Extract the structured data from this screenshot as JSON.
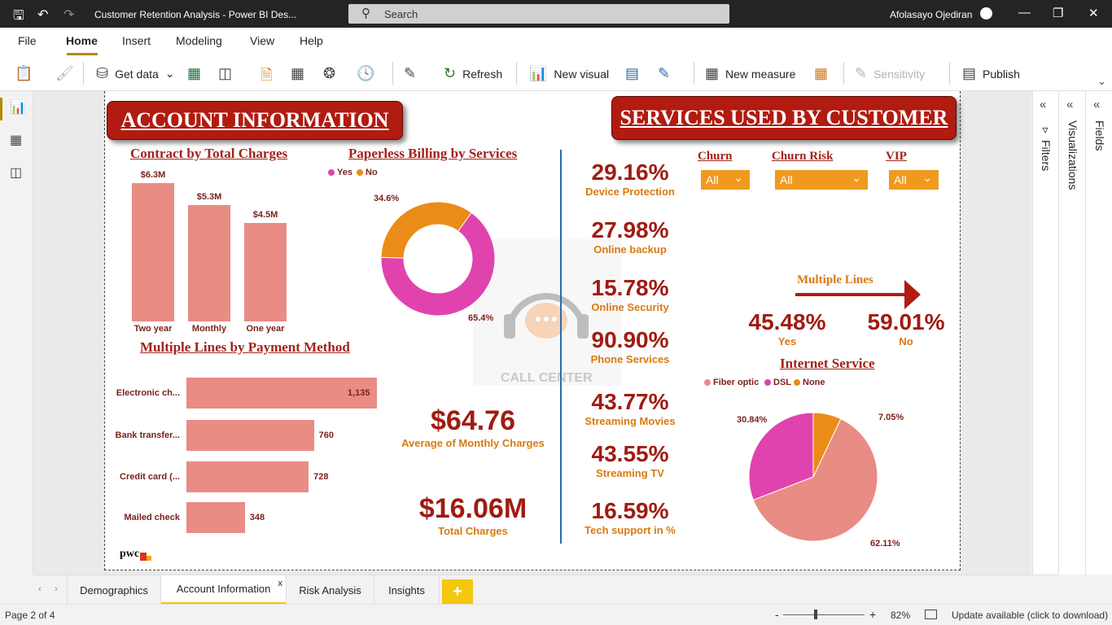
{
  "titlebar": {
    "title": "Customer Retention Analysis - Power BI Des...",
    "search_placeholder": "Search",
    "user": "Afolasayo Ojediran"
  },
  "menu": {
    "items": [
      "File",
      "Home",
      "Insert",
      "Modeling",
      "View",
      "Help"
    ],
    "active": "Home"
  },
  "ribbon": {
    "get_data": "Get data",
    "refresh": "Refresh",
    "new_visual": "New visual",
    "new_measure": "New measure",
    "sensitivity": "Sensitivity",
    "publish": "Publish"
  },
  "panes": {
    "filters": "Filters",
    "visualizations": "Visualizations",
    "fields": "Fields"
  },
  "tabs": [
    {
      "label": "Demographics"
    },
    {
      "label": "Account Information",
      "active": true
    },
    {
      "label": "Risk Analysis"
    },
    {
      "label": "Insights"
    }
  ],
  "tab_close": "x",
  "tab_add": "+",
  "status": {
    "page": "Page 2 of 4",
    "zoom": "82%",
    "update": "Update available (click to download)"
  },
  "report": {
    "account_banner": "ACCOUNT INFORMATION",
    "services_banner": "SERVICES USED BY CUSTOMER",
    "contract_title": "Contract by Total Charges",
    "paperless_title": "Paperless Billing by Services",
    "multiple_lines_title": "Multiple Lines by Payment Method",
    "internet_title": "Internet Service",
    "multiple_lines_label": "Multiple Lines",
    "watermark": "CALL CENTER",
    "logo": "pwc",
    "kpis": {
      "avg_monthly_value": "$64.76",
      "avg_monthly_label": "Average of Monthly Charges",
      "total_value": "$16.06M",
      "total_label": "Total Charges"
    },
    "services": [
      {
        "value": "29.16%",
        "label": "Device Protection"
      },
      {
        "value": "27.98%",
        "label": "Online backup"
      },
      {
        "value": "15.78%",
        "label": "Online Security"
      },
      {
        "value": "90.90%",
        "label": "Phone Services"
      },
      {
        "value": "43.77%",
        "label": "Streaming Movies"
      },
      {
        "value": "43.55%",
        "label": "Streaming TV"
      },
      {
        "value": "16.59%",
        "label": "Tech support in %"
      }
    ],
    "multiple_lines": {
      "yes_value": "45.48%",
      "yes_label": "Yes",
      "no_value": "59.01%",
      "no_label": "No"
    },
    "slicers": [
      {
        "label": "Churn",
        "value": "All"
      },
      {
        "label": "Churn Risk",
        "value": "All"
      },
      {
        "label": "VIP",
        "value": "All"
      }
    ]
  },
  "chart_data": [
    {
      "type": "bar",
      "title": "Contract by Total Charges",
      "categories": [
        "Two year",
        "Monthly",
        "One year"
      ],
      "values": [
        6.3,
        5.3,
        4.5
      ],
      "labels": [
        "$6.3M",
        "$5.3M",
        "$4.5M"
      ],
      "color": "#e98c83"
    },
    {
      "type": "pie",
      "subtype": "donut",
      "title": "Paperless Billing by Services",
      "legend": [
        "Yes",
        "No"
      ],
      "values": [
        65.4,
        34.6
      ],
      "labels": [
        "65.4%",
        "34.6%"
      ],
      "colors": [
        "#e043ad",
        "#ea8c17"
      ]
    },
    {
      "type": "bar",
      "orientation": "horizontal",
      "title": "Multiple Lines by Payment Method",
      "categories": [
        "Electronic ch...",
        "Bank transfer...",
        "Credit card (...",
        "Mailed check"
      ],
      "values": [
        1135,
        760,
        728,
        348
      ],
      "labels": [
        "1,135",
        "760",
        "728",
        "348"
      ],
      "color": "#e98c83"
    },
    {
      "type": "pie",
      "title": "Internet Service",
      "legend": [
        "Fiber optic",
        "DSL",
        "None"
      ],
      "values": [
        62.11,
        30.84,
        7.05
      ],
      "labels": [
        "62.11%",
        "30.84%",
        "7.05%"
      ],
      "colors": [
        "#e98c83",
        "#e043ad",
        "#ea8c17"
      ]
    }
  ]
}
